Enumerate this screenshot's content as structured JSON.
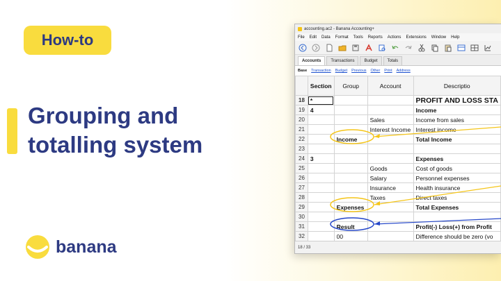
{
  "badge": "How-to",
  "headline": "Grouping and totalling system",
  "brand": {
    "name": "banana",
    "logo_icon": "banana-logo-icon",
    "color": "#2d3a82",
    "accent": "#f9dc3e"
  },
  "window": {
    "title": "accounting.ac2 - Banana Accounting+",
    "menu": [
      "File",
      "Edit",
      "Data",
      "Format",
      "Tools",
      "Reports",
      "Actions",
      "Extensions",
      "Window",
      "Help"
    ],
    "toolbar_icons": [
      "back-icon",
      "forward-icon",
      "new-file-icon",
      "open-folder-icon",
      "save-icon",
      "pdf-icon",
      "print-preview-icon",
      "undo-icon",
      "redo-icon",
      "cut-icon",
      "copy-icon",
      "paste-icon",
      "add-row-icon",
      "insert-row-icon",
      "chart-icon"
    ],
    "tabs": [
      "Accounts",
      "Transactions",
      "Budget",
      "Totals"
    ],
    "active_tab": "Accounts",
    "views": [
      "Base",
      "Transaction",
      "Budget",
      "Previous",
      "Other",
      "Print",
      "Address"
    ],
    "columns": [
      "Section",
      "Group",
      "Account",
      "Descriptio"
    ],
    "rows": [
      {
        "n": "18",
        "section": "*",
        "group": "",
        "account": "",
        "desc": "PROFIT AND LOSS STA"
      },
      {
        "n": "19",
        "section": "4",
        "group": "",
        "account": "",
        "desc": "Income"
      },
      {
        "n": "20",
        "section": "",
        "group": "",
        "account": "Sales",
        "desc": "Income from sales"
      },
      {
        "n": "21",
        "section": "",
        "group": "",
        "account": "Interest Income",
        "desc": "Interest income"
      },
      {
        "n": "22",
        "section": "",
        "group": "Income",
        "account": "",
        "desc": "Total Income"
      },
      {
        "n": "23",
        "section": "",
        "group": "",
        "account": "",
        "desc": ""
      },
      {
        "n": "24",
        "section": "3",
        "group": "",
        "account": "",
        "desc": "Expenses"
      },
      {
        "n": "25",
        "section": "",
        "group": "",
        "account": "Goods",
        "desc": "Cost of goods"
      },
      {
        "n": "26",
        "section": "",
        "group": "",
        "account": "Salary",
        "desc": "Personnel expenses"
      },
      {
        "n": "27",
        "section": "",
        "group": "",
        "account": "Insurance",
        "desc": "Health insurance"
      },
      {
        "n": "28",
        "section": "",
        "group": "",
        "account": "Taxes",
        "desc": "Direct taxes"
      },
      {
        "n": "29",
        "section": "",
        "group": "Expenses",
        "account": "",
        "desc": "Total Expenses"
      },
      {
        "n": "30",
        "section": "",
        "group": "",
        "account": "",
        "desc": ""
      },
      {
        "n": "31",
        "section": "",
        "group": "Result",
        "account": "",
        "desc": "Profit(-) Loss(+) from Profit"
      },
      {
        "n": "32",
        "section": "",
        "group": "00",
        "account": "",
        "desc": "Difference should be zero (vo"
      }
    ],
    "status": "18 / 33"
  },
  "highlight_colors": {
    "yellow": "#f5c518",
    "blue": "#2547c9"
  }
}
